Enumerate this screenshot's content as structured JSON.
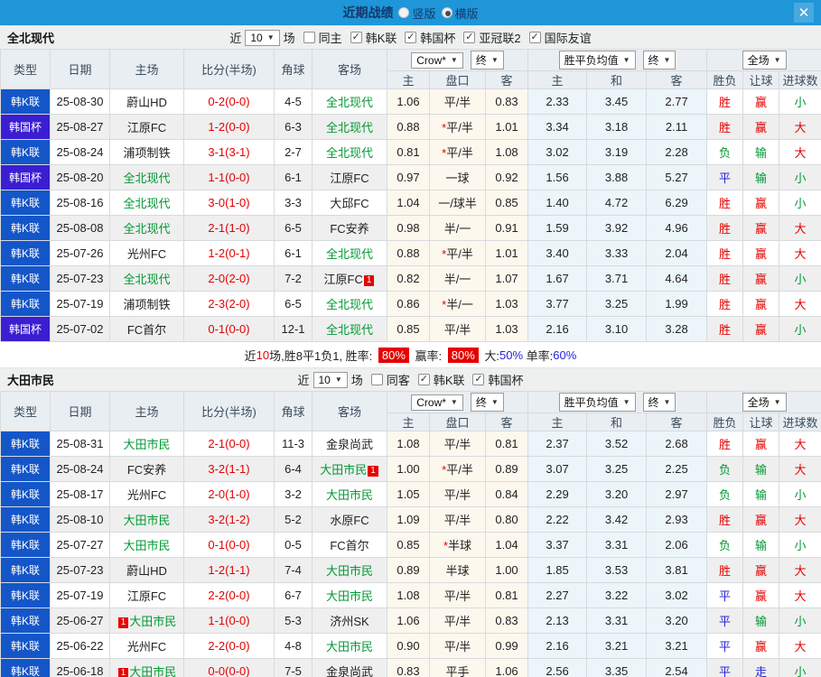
{
  "titlebar": {
    "title": "近期战绩",
    "radios": [
      {
        "label": "竖版",
        "selected": false
      },
      {
        "label": "横版",
        "selected": true
      }
    ],
    "close_icon": "✕"
  },
  "colors": {
    "titlebar_bg": "#1e96d7",
    "league_k_badge": "#1456c8",
    "league_cup_badge": "#3b1ed2",
    "focal_team": "#009933",
    "score_red": "#e60000",
    "asian_odds_bg": "#fdf8ee",
    "euro_odds_bg": "#ecf5fa"
  },
  "table_header": {
    "cols": [
      "类型",
      "日期",
      "主场",
      "比分(半场)",
      "角球",
      "客场"
    ],
    "sub": [
      "主",
      "盘口",
      "客",
      "主",
      "和",
      "客",
      "胜负",
      "让球",
      "进球数"
    ],
    "dropdowns": {
      "odds_company": "Crow*",
      "odds_final": "终",
      "euro_label": "胜平负均值",
      "euro_final": "终",
      "scope": "全场"
    }
  },
  "result_colors": {
    "胜": "res-red",
    "负": "res-green",
    "平": "res-blue",
    "赢": "res-red",
    "输": "res-green",
    "走": "res-blue",
    "大": "res-red",
    "小": "res-green"
  },
  "sections": [
    {
      "team": "全北现代",
      "filters": {
        "prefix": "近",
        "count": "10",
        "suffix": "场",
        "checks": [
          {
            "label": "同主",
            "checked": false
          },
          {
            "label": "韩K联",
            "checked": true
          },
          {
            "label": "韩国杯",
            "checked": true
          },
          {
            "label": "亚冠联2",
            "checked": true
          },
          {
            "label": "国际友谊",
            "checked": true
          }
        ]
      },
      "rows": [
        {
          "lg": "韩K联",
          "cup": false,
          "date": "25-08-30",
          "h": "蔚山HD",
          "hf": false,
          "hb": null,
          "s": "0-2",
          "hs": "(0-0)",
          "c": "4-5",
          "a": "全北现代",
          "af": true,
          "ab": null,
          "o1": "1.06",
          "hk": "平/半",
          "st": false,
          "o2": "0.83",
          "e1": "2.33",
          "ex": "3.45",
          "e2": "2.77",
          "r1": "胜",
          "r2": "赢",
          "r3": "小"
        },
        {
          "lg": "韩国杯",
          "cup": true,
          "date": "25-08-27",
          "h": "江原FC",
          "hf": false,
          "hb": null,
          "s": "1-2",
          "hs": "(0-0)",
          "c": "6-3",
          "a": "全北现代",
          "af": true,
          "ab": null,
          "o1": "0.88",
          "hk": "平/半",
          "st": true,
          "o2": "1.01",
          "e1": "3.34",
          "ex": "3.18",
          "e2": "2.11",
          "r1": "胜",
          "r2": "赢",
          "r3": "大"
        },
        {
          "lg": "韩K联",
          "cup": false,
          "date": "25-08-24",
          "h": "浦项制铁",
          "hf": false,
          "hb": null,
          "s": "3-1",
          "hs": "(3-1)",
          "c": "2-7",
          "a": "全北现代",
          "af": true,
          "ab": null,
          "o1": "0.81",
          "hk": "平/半",
          "st": true,
          "o2": "1.08",
          "e1": "3.02",
          "ex": "3.19",
          "e2": "2.28",
          "r1": "负",
          "r2": "输",
          "r3": "大"
        },
        {
          "lg": "韩国杯",
          "cup": true,
          "date": "25-08-20",
          "h": "全北现代",
          "hf": true,
          "hb": null,
          "s": "1-1",
          "hs": "(0-0)",
          "c": "6-1",
          "a": "江原FC",
          "af": false,
          "ab": null,
          "o1": "0.97",
          "hk": "一球",
          "st": false,
          "o2": "0.92",
          "e1": "1.56",
          "ex": "3.88",
          "e2": "5.27",
          "r1": "平",
          "r2": "输",
          "r3": "小"
        },
        {
          "lg": "韩K联",
          "cup": false,
          "date": "25-08-16",
          "h": "全北现代",
          "hf": true,
          "hb": null,
          "s": "3-0",
          "hs": "(1-0)",
          "c": "3-3",
          "a": "大邱FC",
          "af": false,
          "ab": null,
          "o1": "1.04",
          "hk": "一/球半",
          "st": false,
          "o2": "0.85",
          "e1": "1.40",
          "ex": "4.72",
          "e2": "6.29",
          "r1": "胜",
          "r2": "赢",
          "r3": "小"
        },
        {
          "lg": "韩K联",
          "cup": false,
          "date": "25-08-08",
          "h": "全北现代",
          "hf": true,
          "hb": null,
          "s": "2-1",
          "hs": "(1-0)",
          "c": "6-5",
          "a": "FC安养",
          "af": false,
          "ab": null,
          "o1": "0.98",
          "hk": "半/一",
          "st": false,
          "o2": "0.91",
          "e1": "1.59",
          "ex": "3.92",
          "e2": "4.96",
          "r1": "胜",
          "r2": "赢",
          "r3": "大"
        },
        {
          "lg": "韩K联",
          "cup": false,
          "date": "25-07-26",
          "h": "光州FC",
          "hf": false,
          "hb": null,
          "s": "1-2",
          "hs": "(0-1)",
          "c": "6-1",
          "a": "全北现代",
          "af": true,
          "ab": null,
          "o1": "0.88",
          "hk": "平/半",
          "st": true,
          "o2": "1.01",
          "e1": "3.40",
          "ex": "3.33",
          "e2": "2.04",
          "r1": "胜",
          "r2": "赢",
          "r3": "大"
        },
        {
          "lg": "韩K联",
          "cup": false,
          "date": "25-07-23",
          "h": "全北现代",
          "hf": true,
          "hb": null,
          "s": "2-0",
          "hs": "(2-0)",
          "c": "7-2",
          "a": "江原FC",
          "af": false,
          "ab": "1",
          "o1": "0.82",
          "hk": "半/一",
          "st": false,
          "o2": "1.07",
          "e1": "1.67",
          "ex": "3.71",
          "e2": "4.64",
          "r1": "胜",
          "r2": "赢",
          "r3": "小"
        },
        {
          "lg": "韩K联",
          "cup": false,
          "date": "25-07-19",
          "h": "浦项制铁",
          "hf": false,
          "hb": null,
          "s": "2-3",
          "hs": "(2-0)",
          "c": "6-5",
          "a": "全北现代",
          "af": true,
          "ab": null,
          "o1": "0.86",
          "hk": "半/一",
          "st": true,
          "o2": "1.03",
          "e1": "3.77",
          "ex": "3.25",
          "e2": "1.99",
          "r1": "胜",
          "r2": "赢",
          "r3": "大"
        },
        {
          "lg": "韩国杯",
          "cup": true,
          "date": "25-07-02",
          "h": "FC首尔",
          "hf": false,
          "hb": null,
          "s": "0-1",
          "hs": "(0-0)",
          "c": "12-1",
          "a": "全北现代",
          "af": true,
          "ab": null,
          "o1": "0.85",
          "hk": "平/半",
          "st": false,
          "o2": "1.03",
          "e1": "2.16",
          "ex": "3.10",
          "e2": "3.28",
          "r1": "胜",
          "r2": "赢",
          "r3": "小"
        }
      ],
      "summary": [
        {
          "t": "近",
          "k": "plain"
        },
        {
          "t": "10",
          "k": "red"
        },
        {
          "t": "场,胜8平1负1, 胜率: ",
          "k": "plain"
        },
        {
          "t": "80%",
          "k": "badge"
        },
        {
          "t": " 赢率: ",
          "k": "plain"
        },
        {
          "t": "80%",
          "k": "badge"
        },
        {
          "t": " 大:",
          "k": "plain"
        },
        {
          "t": "50%",
          "k": "blue"
        },
        {
          "t": " 单率:",
          "k": "plain"
        },
        {
          "t": "60%",
          "k": "blue"
        }
      ]
    },
    {
      "team": "大田市民",
      "filters": {
        "prefix": "近",
        "count": "10",
        "suffix": "场",
        "checks": [
          {
            "label": "同客",
            "checked": false
          },
          {
            "label": "韩K联",
            "checked": true
          },
          {
            "label": "韩国杯",
            "checked": true
          }
        ]
      },
      "rows": [
        {
          "lg": "韩K联",
          "cup": false,
          "date": "25-08-31",
          "h": "大田市民",
          "hf": true,
          "hb": null,
          "s": "2-1",
          "hs": "(0-0)",
          "c": "11-3",
          "a": "金泉尚武",
          "af": false,
          "ab": null,
          "o1": "1.08",
          "hk": "平/半",
          "st": false,
          "o2": "0.81",
          "e1": "2.37",
          "ex": "3.52",
          "e2": "2.68",
          "r1": "胜",
          "r2": "赢",
          "r3": "大"
        },
        {
          "lg": "韩K联",
          "cup": false,
          "date": "25-08-24",
          "h": "FC安养",
          "hf": false,
          "hb": null,
          "s": "3-2",
          "hs": "(1-1)",
          "c": "6-4",
          "a": "大田市民",
          "af": true,
          "ab": "1",
          "o1": "1.00",
          "hk": "平/半",
          "st": true,
          "o2": "0.89",
          "e1": "3.07",
          "ex": "3.25",
          "e2": "2.25",
          "r1": "负",
          "r2": "输",
          "r3": "大"
        },
        {
          "lg": "韩K联",
          "cup": false,
          "date": "25-08-17",
          "h": "光州FC",
          "hf": false,
          "hb": null,
          "s": "2-0",
          "hs": "(1-0)",
          "c": "3-2",
          "a": "大田市民",
          "af": true,
          "ab": null,
          "o1": "1.05",
          "hk": "平/半",
          "st": false,
          "o2": "0.84",
          "e1": "2.29",
          "ex": "3.20",
          "e2": "2.97",
          "r1": "负",
          "r2": "输",
          "r3": "小"
        },
        {
          "lg": "韩K联",
          "cup": false,
          "date": "25-08-10",
          "h": "大田市民",
          "hf": true,
          "hb": null,
          "s": "3-2",
          "hs": "(1-2)",
          "c": "5-2",
          "a": "水原FC",
          "af": false,
          "ab": null,
          "o1": "1.09",
          "hk": "平/半",
          "st": false,
          "o2": "0.80",
          "e1": "2.22",
          "ex": "3.42",
          "e2": "2.93",
          "r1": "胜",
          "r2": "赢",
          "r3": "大"
        },
        {
          "lg": "韩K联",
          "cup": false,
          "date": "25-07-27",
          "h": "大田市民",
          "hf": true,
          "hb": null,
          "s": "0-1",
          "hs": "(0-0)",
          "c": "0-5",
          "a": "FC首尔",
          "af": false,
          "ab": null,
          "o1": "0.85",
          "hk": "半球",
          "st": true,
          "o2": "1.04",
          "e1": "3.37",
          "ex": "3.31",
          "e2": "2.06",
          "r1": "负",
          "r2": "输",
          "r3": "小"
        },
        {
          "lg": "韩K联",
          "cup": false,
          "date": "25-07-23",
          "h": "蔚山HD",
          "hf": false,
          "hb": null,
          "s": "1-2",
          "hs": "(1-1)",
          "c": "7-4",
          "a": "大田市民",
          "af": true,
          "ab": null,
          "o1": "0.89",
          "hk": "半球",
          "st": false,
          "o2": "1.00",
          "e1": "1.85",
          "ex": "3.53",
          "e2": "3.81",
          "r1": "胜",
          "r2": "赢",
          "r3": "大"
        },
        {
          "lg": "韩K联",
          "cup": false,
          "date": "25-07-19",
          "h": "江原FC",
          "hf": false,
          "hb": null,
          "s": "2-2",
          "hs": "(0-0)",
          "c": "6-7",
          "a": "大田市民",
          "af": true,
          "ab": null,
          "o1": "1.08",
          "hk": "平/半",
          "st": false,
          "o2": "0.81",
          "e1": "2.27",
          "ex": "3.22",
          "e2": "3.02",
          "r1": "平",
          "r2": "赢",
          "r3": "大"
        },
        {
          "lg": "韩K联",
          "cup": false,
          "date": "25-06-27",
          "h": "大田市民",
          "hf": true,
          "hb": "1",
          "s": "1-1",
          "hs": "(0-0)",
          "c": "5-3",
          "a": "济州SK",
          "af": false,
          "ab": null,
          "o1": "1.06",
          "hk": "平/半",
          "st": false,
          "o2": "0.83",
          "e1": "2.13",
          "ex": "3.31",
          "e2": "3.20",
          "r1": "平",
          "r2": "输",
          "r3": "小"
        },
        {
          "lg": "韩K联",
          "cup": false,
          "date": "25-06-22",
          "h": "光州FC",
          "hf": false,
          "hb": null,
          "s": "2-2",
          "hs": "(0-0)",
          "c": "4-8",
          "a": "大田市民",
          "af": true,
          "ab": null,
          "o1": "0.90",
          "hk": "平/半",
          "st": false,
          "o2": "0.99",
          "e1": "2.16",
          "ex": "3.21",
          "e2": "3.21",
          "r1": "平",
          "r2": "赢",
          "r3": "大"
        },
        {
          "lg": "韩K联",
          "cup": false,
          "date": "25-06-18",
          "h": "大田市民",
          "hf": true,
          "hb": "1",
          "s": "0-0",
          "hs": "(0-0)",
          "c": "7-5",
          "a": "金泉尚武",
          "af": false,
          "ab": null,
          "o1": "0.83",
          "hk": "平手",
          "st": false,
          "o2": "1.06",
          "e1": "2.56",
          "ex": "3.35",
          "e2": "2.54",
          "r1": "平",
          "r2": "走",
          "r3": "小"
        }
      ],
      "summary": null
    }
  ]
}
